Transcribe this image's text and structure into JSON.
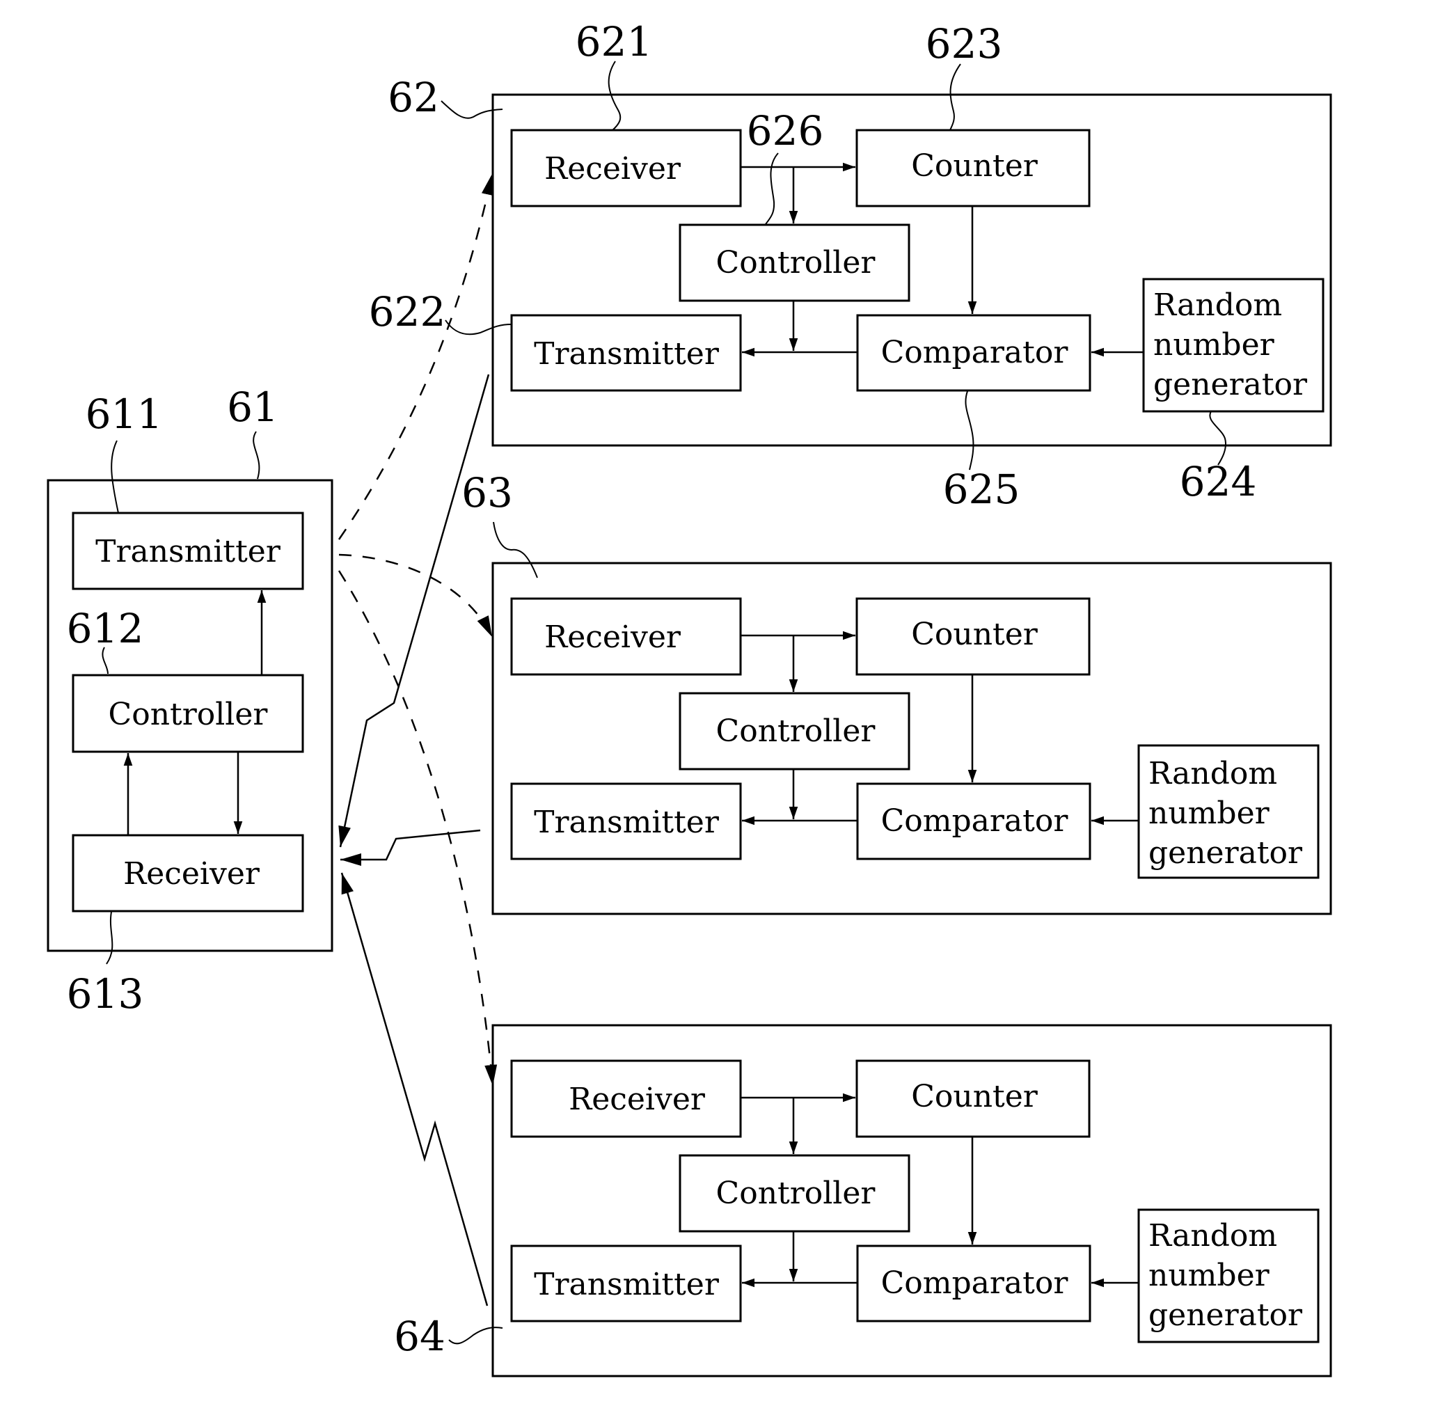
{
  "figure": {
    "description": "Block diagram of a central node communicating with three remote nodes",
    "colors": {
      "ink": "#000000",
      "background": "#ffffff"
    }
  },
  "main_unit": {
    "ref": "61",
    "blocks": {
      "transmitter": {
        "ref": "611",
        "label": "Transmitter"
      },
      "controller": {
        "ref": "612",
        "label": "Controller"
      },
      "receiver": {
        "ref": "613",
        "label": "Receiver"
      }
    }
  },
  "remote_units": [
    {
      "ref": "62",
      "blocks": {
        "receiver": {
          "ref": "621",
          "label": "Receiver"
        },
        "transmitter": {
          "ref": "622",
          "label": "Transmitter"
        },
        "counter": {
          "ref": "623",
          "label": "Counter"
        },
        "rng": {
          "ref": "624",
          "label_lines": [
            "Random",
            "number",
            "generator"
          ]
        },
        "comparator": {
          "ref": "625",
          "label": "Comparator"
        },
        "controller": {
          "ref": "626",
          "label": "Controller"
        }
      }
    },
    {
      "ref": "63",
      "blocks": {
        "receiver": {
          "label": "Receiver"
        },
        "transmitter": {
          "label": "Transmitter"
        },
        "counter": {
          "label": "Counter"
        },
        "rng": {
          "label_lines": [
            "Random",
            "number",
            "generator"
          ]
        },
        "comparator": {
          "label": "Comparator"
        },
        "controller": {
          "label": "Controller"
        }
      }
    },
    {
      "ref": "64",
      "blocks": {
        "receiver": {
          "label": "Receiver"
        },
        "transmitter": {
          "label": "Transmitter"
        },
        "counter": {
          "label": "Counter"
        },
        "rng": {
          "label_lines": [
            "Random",
            "number",
            "generator"
          ]
        },
        "comparator": {
          "label": "Comparator"
        },
        "controller": {
          "label": "Controller"
        }
      }
    }
  ],
  "links": {
    "downlink_style": "dashed",
    "uplink_style": "zigzag-solid",
    "downlinks": [
      "61->62",
      "61->63",
      "61->64"
    ],
    "uplinks": [
      "62->61",
      "63->61",
      "64->61"
    ]
  }
}
